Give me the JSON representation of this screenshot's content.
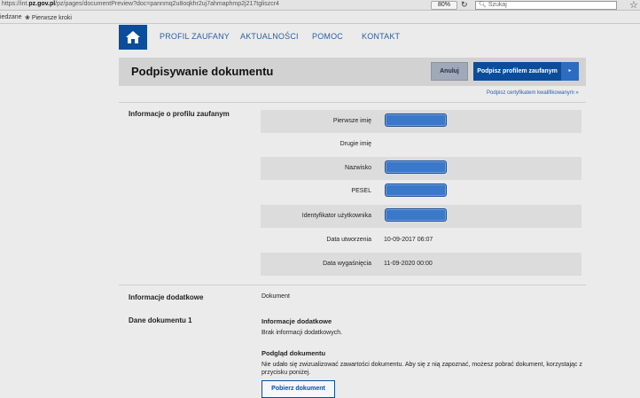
{
  "browser": {
    "url_prefix": "https://int.",
    "url_domain": "pz.gov.pl",
    "url_path": "/pz/pages/documentPreview?doc=pannmq2u8oqkhr2uj7ahmaphmp2j217tgliszcr4",
    "zoom": "80%",
    "search_placeholder": "Szukaj",
    "bookmark_partial": "iedzane",
    "bookmark_first_steps": "Pierwsze kroki"
  },
  "nav": {
    "items": [
      "PROFIL ZAUFANY",
      "AKTUALNOŚCI",
      "POMOC",
      "KONTAKT"
    ]
  },
  "header": {
    "title": "Podpisywanie dokumentu",
    "cancel_label": "Anuluj",
    "sign_label": "Podpisz profilem zaufanym",
    "sign_arrow": "▸",
    "qualified_link": "Podpisz certyfikatem kwalifikowanym »"
  },
  "profile": {
    "section_title": "Informacje o profilu zaufanym",
    "rows": [
      {
        "label": "Pierwsze imię",
        "value": "",
        "redacted": true
      },
      {
        "label": "Drugie imię",
        "value": "",
        "redacted": false
      },
      {
        "label": "Nazwisko",
        "value": "",
        "redacted": true
      },
      {
        "label": "PESEL",
        "value": "",
        "redacted": true
      },
      {
        "label": "Identyfikator użytkownika",
        "value": "",
        "redacted": true
      },
      {
        "label": "Data utworzenia",
        "value": "10-09-2017 06:07",
        "redacted": false
      },
      {
        "label": "Data wygaśnięcia",
        "value": "11-09-2020 00:00",
        "redacted": false
      }
    ]
  },
  "additional": {
    "section_title": "Informacje dodatkowe",
    "value": "Dokument"
  },
  "document": {
    "section_title": "Dane dokumentu 1",
    "info_heading": "Informacje dodatkowe",
    "info_text": "Brak informacji dodatkowych.",
    "preview_heading": "Podgląd dokumentu",
    "preview_text_line1": "Nie udało się zwizualizować zawartości dokumentu. Aby się z nią zapoznać, możesz pobrać dokument, korzystając z",
    "preview_text_line2": "przycisku poniżej.",
    "download_label": "Pobierz dokument"
  },
  "colors": {
    "brand_blue": "#0b4d9b",
    "redaction_blue": "#3a78c9",
    "link_blue": "#2a5ea8"
  }
}
